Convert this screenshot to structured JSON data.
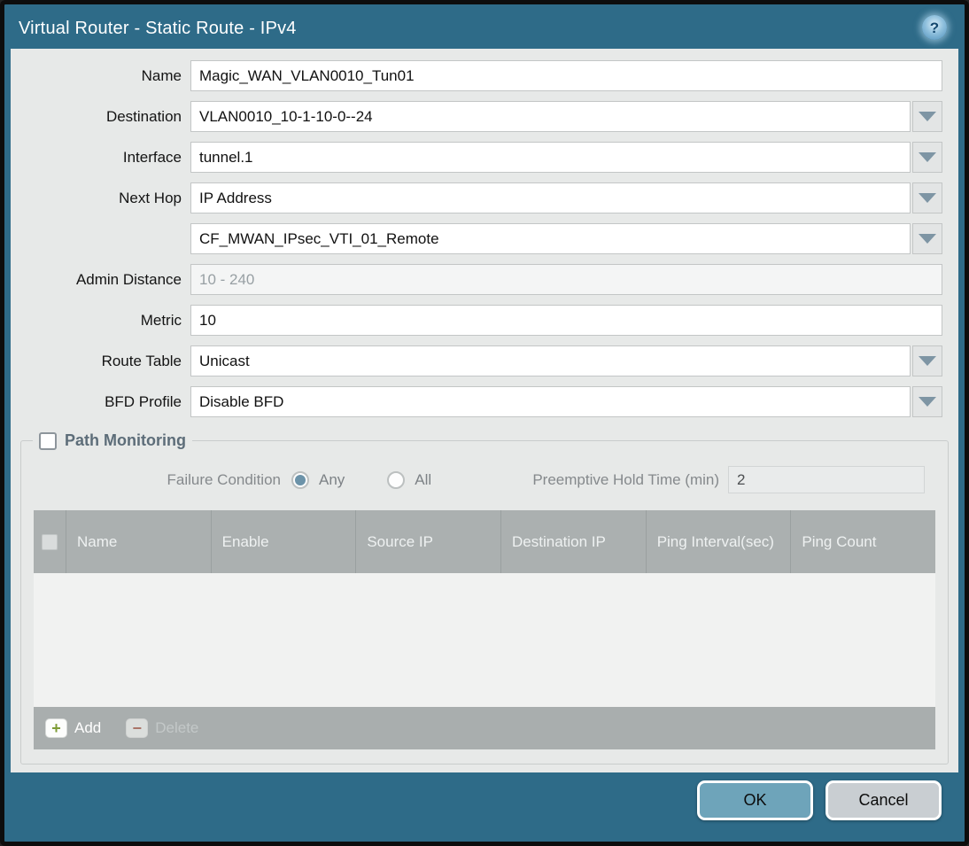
{
  "window": {
    "title": "Virtual Router - Static Route - IPv4",
    "help_glyph": "?"
  },
  "form": {
    "rows": [
      {
        "label": "Name",
        "value": "Magic_WAN_VLAN0010_Tun01",
        "placeholder": "",
        "has_dropdown": false,
        "disabled_look": false
      },
      {
        "label": "Destination",
        "value": "VLAN0010_10-1-10-0--24",
        "placeholder": "",
        "has_dropdown": true,
        "disabled_look": false
      },
      {
        "label": "Interface",
        "value": "tunnel.1",
        "placeholder": "",
        "has_dropdown": true,
        "disabled_look": false
      },
      {
        "label": "Next Hop",
        "value": "IP Address",
        "placeholder": "",
        "has_dropdown": true,
        "disabled_look": false
      },
      {
        "label": "",
        "value": "CF_MWAN_IPsec_VTI_01_Remote",
        "placeholder": "",
        "has_dropdown": true,
        "disabled_look": false
      },
      {
        "label": "Admin Distance",
        "value": "",
        "placeholder": "10 - 240",
        "has_dropdown": false,
        "disabled_look": true
      },
      {
        "label": "Metric",
        "value": "10",
        "placeholder": "",
        "has_dropdown": false,
        "disabled_look": false
      },
      {
        "label": "Route Table",
        "value": "Unicast",
        "placeholder": "",
        "has_dropdown": true,
        "disabled_look": false
      },
      {
        "label": "BFD Profile",
        "value": "Disable BFD",
        "placeholder": "",
        "has_dropdown": true,
        "disabled_look": false
      }
    ]
  },
  "path_monitoring": {
    "legend": "Path Monitoring",
    "checkbox_checked": false,
    "failure_condition_label": "Failure Condition",
    "radio_options": [
      {
        "label": "Any",
        "selected": true
      },
      {
        "label": "All",
        "selected": false
      }
    ],
    "preemptive_label": "Preemptive Hold Time (min)",
    "preemptive_value": "2",
    "table": {
      "columns": [
        "Name",
        "Enable",
        "Source IP",
        "Destination IP",
        "Ping Interval(sec)",
        "Ping Count"
      ],
      "rows": [],
      "add_label": "Add",
      "delete_label": "Delete"
    }
  },
  "footer": {
    "ok_label": "OK",
    "cancel_label": "Cancel"
  },
  "colors": {
    "titlebar": "#2e6b88",
    "panel_bg": "#e7e9e8",
    "table_header_bg": "#abb0b0",
    "table_body_bg": "#f1f2f1",
    "table_footer_bg": "#a9aeae",
    "ok_button": "#6ea4ba",
    "cancel_button": "#c9ced2",
    "legend_text": "#5d6d79",
    "dropdown_arrow": "#7e95a4",
    "radio_selected": "#6c93a9",
    "add_plus": "#7d9c35",
    "delete_minus": "#a9604f"
  }
}
